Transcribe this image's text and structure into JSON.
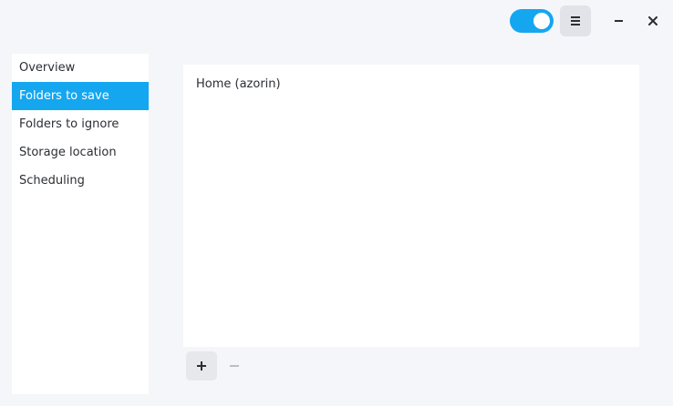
{
  "header": {
    "toggle_state": "on",
    "menu_icon": "hamburger-menu-icon",
    "minimize_icon": "minimize-icon",
    "close_icon": "close-icon"
  },
  "sidebar": {
    "items": [
      {
        "label": "Overview",
        "selected": false
      },
      {
        "label": "Folders to save",
        "selected": true
      },
      {
        "label": "Folders to ignore",
        "selected": false
      },
      {
        "label": "Storage location",
        "selected": false
      },
      {
        "label": "Scheduling",
        "selected": false
      }
    ]
  },
  "main": {
    "folders": [
      {
        "label": "Home (azorin)"
      }
    ],
    "add_icon": "plus-icon",
    "remove_icon": "minus-icon"
  },
  "colors": {
    "accent": "#15a6f0",
    "background": "#f5f6f9",
    "panel": "#ffffff",
    "text": "#2b2e33"
  }
}
